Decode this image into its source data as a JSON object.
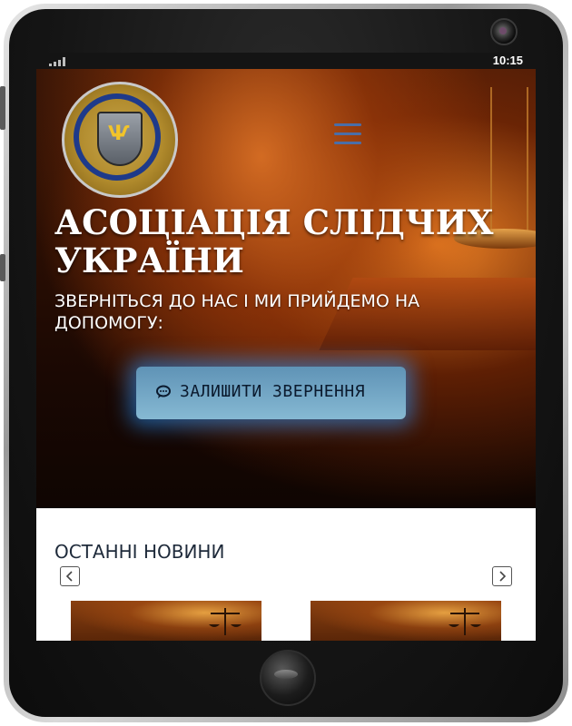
{
  "statusbar": {
    "time": "10:15",
    "signal_icon": "signal-bars-icon"
  },
  "header": {
    "logo_icon": "association-emblem-icon",
    "menu_icon": "hamburger-menu-icon"
  },
  "hero": {
    "title_line1": "АСОЦІАЦІЯ СЛІДЧИХ",
    "title_line2": "УКРАЇНИ",
    "subtitle_line1": "ЗВЕРНІТЬСЯ ДО НАС І МИ ПРИЙДЕМО НА",
    "subtitle_line2": "ДОПОМОГУ:",
    "cta_label": "ЗАЛИШИТИ ЗВЕРНЕННЯ",
    "cta_icon": "chat-bubble-icon",
    "accent_glow": "#2896ff"
  },
  "news": {
    "heading": "ОСТАННІ НОВИНИ",
    "prev_icon": "chevron-left-icon",
    "next_icon": "chevron-right-icon"
  },
  "colors": {
    "hero_bg": "#2a0e03",
    "cta_bg": "#86b9d3",
    "menu": "#4a6ea8"
  }
}
